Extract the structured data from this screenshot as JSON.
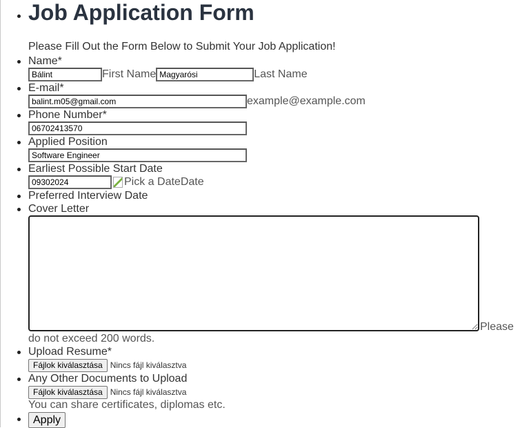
{
  "form": {
    "title": "Job Application Form",
    "subtitle": "Please Fill Out the Form Below to Submit Your Job Application!",
    "name": {
      "label": "Name*",
      "first_value": "Bálint",
      "first_hint": "First Name",
      "last_value": "Magyarósi",
      "last_hint": "Last Name"
    },
    "email": {
      "label": "E-mail*",
      "value": "balint.m05@gmail.com",
      "hint": "example@example.com"
    },
    "phone": {
      "label": "Phone Number*",
      "value": "06702413570"
    },
    "position": {
      "label": "Applied Position",
      "value": "Software Engineer"
    },
    "start_date": {
      "label": "Earliest Possible Start Date",
      "value": "09302024",
      "picker_alt": "Pick a Date",
      "picker_suffix": "Date"
    },
    "interview": {
      "label": "Preferred Interview Date"
    },
    "cover_letter": {
      "label": "Cover Letter",
      "value": "",
      "hint_tail": "Please",
      "hint_rest": "do not exceed 200 words."
    },
    "resume": {
      "label": "Upload Resume*",
      "button": "Fájlok kiválasztása",
      "status": "Nincs fájl kiválasztva"
    },
    "other_docs": {
      "label": "Any Other Documents to Upload",
      "button": "Fájlok kiválasztása",
      "status": "Nincs fájl kiválasztva",
      "hint": "You can share certificates, diplomas etc."
    },
    "apply_label": "Apply"
  }
}
